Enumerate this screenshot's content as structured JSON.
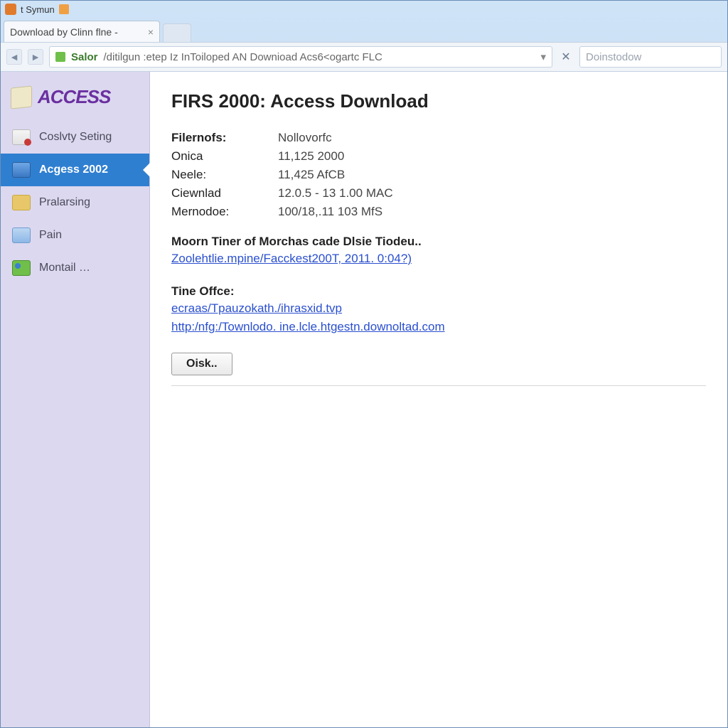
{
  "titlebar": {
    "text": "t Symun"
  },
  "tab": {
    "title": "Download by Clinn flne -"
  },
  "address": {
    "host": "Salor",
    "path": "/ditilgun :etep Iz InToiloped AN Downioad Acs6<ogartc FLC"
  },
  "search": {
    "placeholder": "Doinstodow"
  },
  "brand": "ACCESS",
  "sidebar": {
    "items": [
      {
        "label": "Coslvty Seting"
      },
      {
        "label": "Acgess 2002"
      },
      {
        "label": "Pralarsing"
      },
      {
        "label": "Pain"
      },
      {
        "label": "Montail …"
      }
    ]
  },
  "main": {
    "heading": "FIRS 2000: Access Download",
    "rows": [
      {
        "k": "Filernofs:",
        "v": "Nollovorfc",
        "bold": true
      },
      {
        "k": "Onica",
        "v": "11,125 2000"
      },
      {
        "k": "Neele:",
        "v": "11,425 AfCB"
      },
      {
        "k": "Ciewnlad",
        "v": "12.0.5 - 13 1.00 MAC"
      },
      {
        "k": "Mernodoe:",
        "v": "100/18,.11 103 MfS"
      }
    ],
    "section1_title": "Moorn Tiner of Morchas cade Dlsie Tiodeu..",
    "link1": "Zoolehtlie.mpine/Facckest200T, 2011. 0:04?)",
    "section2_title": "Tine Offce:",
    "link2a": "ecraas/Tpauzokath./ihrasxid.tvp",
    "link2b": "http:/nfg:/Townlodo. ine.lcle.htgestn.downoltad.com",
    "button": "Oisk.."
  }
}
